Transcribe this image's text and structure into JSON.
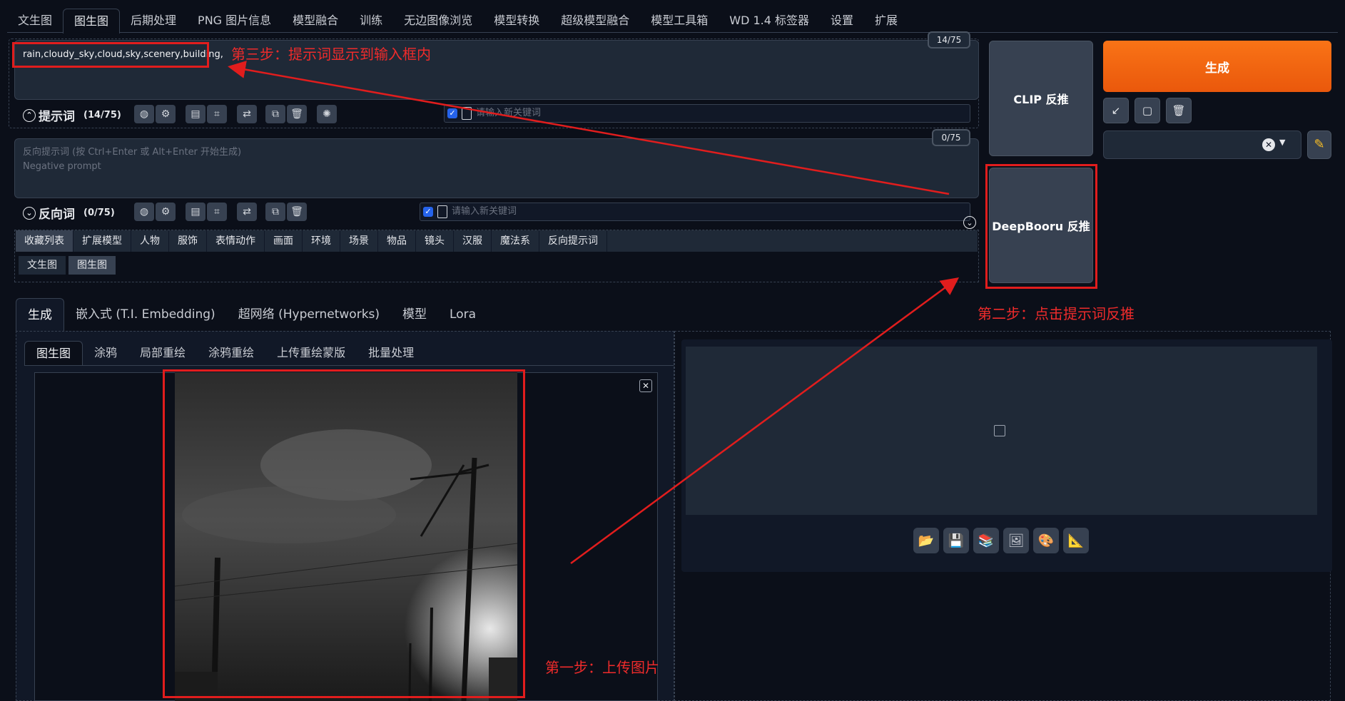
{
  "top_tabs": [
    "文生图",
    "图生图",
    "后期处理",
    "PNG 图片信息",
    "模型融合",
    "训练",
    "无边图像浏览",
    "模型转换",
    "超级模型融合",
    "模型工具箱",
    "WD 1.4 标签器",
    "设置",
    "扩展"
  ],
  "prompt": {
    "value": "rain,cloudy_sky,cloud,sky,scenery,building,",
    "counter": "14/75",
    "label": "提示词",
    "count": "(14/75)",
    "keyword_placeholder": "请输入新关键词"
  },
  "negative": {
    "placeholder_line1": "反向提示词 (按 Ctrl+Enter 或 Alt+Enter 开始生成)",
    "placeholder_line2": "Negative prompt",
    "counter": "0/75",
    "label": "反向词",
    "count": "(0/75)",
    "keyword_placeholder": "请输入新关键词"
  },
  "categories": [
    "收藏列表",
    "扩展模型",
    "人物",
    "服饰",
    "表情动作",
    "画面",
    "环境",
    "场景",
    "物品",
    "镜头",
    "汉服",
    "魔法系",
    "反向提示词"
  ],
  "category_sub": [
    "文生图",
    "图生图"
  ],
  "buttons": {
    "clip": "CLIP 反推",
    "deepbooru": "DeepBooru 反推",
    "generate": "生成"
  },
  "sub_tabs": [
    "生成",
    "嵌入式 (T.I. Embedding)",
    "超网络 (Hypernetworks)",
    "模型",
    "Lora"
  ],
  "img_tabs": [
    "图生图",
    "涂鸦",
    "局部重绘",
    "涂鸦重绘",
    "上传重绘蒙版",
    "批量处理"
  ],
  "annotations": {
    "step1": "第一步：上传图片",
    "step2": "第二步：点击提示词反推",
    "step3": "第三步：提示词显示到输入框内"
  },
  "colors": {
    "accent": "#ea580c",
    "annotation": "#e11d1d",
    "background": "#0b0f19"
  }
}
